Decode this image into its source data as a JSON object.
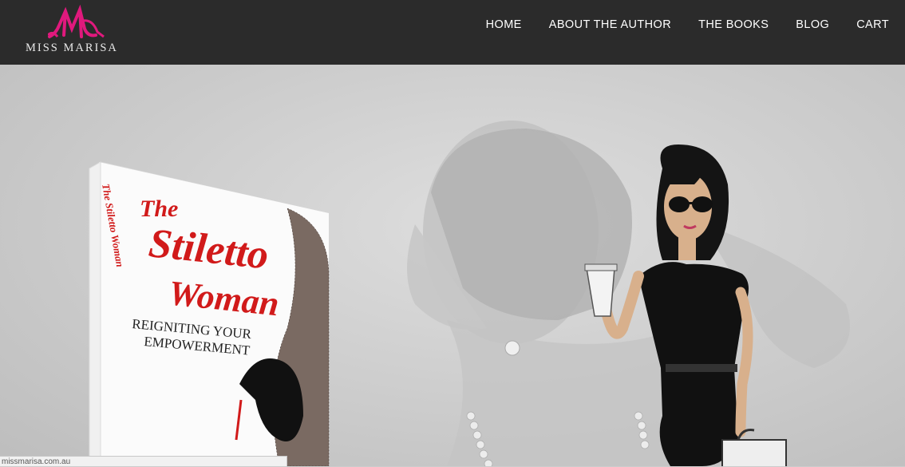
{
  "header": {
    "logo_text": "MISS MARISA",
    "logo_monogram": "M"
  },
  "nav": {
    "items": [
      {
        "label": "HOME"
      },
      {
        "label": "ABOUT THE AUTHOR"
      },
      {
        "label": "THE BOOKS"
      },
      {
        "label": "BLOG"
      },
      {
        "label": "CART"
      }
    ]
  },
  "hero": {
    "book": {
      "title_line1": "The",
      "title_line2": "Stiletto",
      "title_line3": "Woman",
      "subtitle_line1": "REIGNITING YOUR",
      "subtitle_line2": "EMPOWERMENT",
      "spine": "The Stiletto Woman"
    }
  },
  "statusbar": {
    "url": "missmarisa.com.au"
  },
  "colors": {
    "brand_pink": "#e0197d",
    "header_bg": "#2b2b2b",
    "title_red": "#d11a1a"
  }
}
